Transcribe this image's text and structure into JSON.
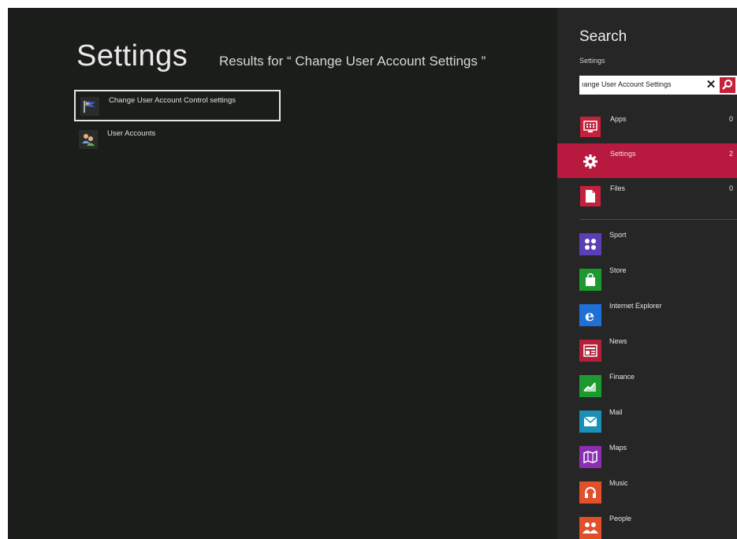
{
  "main": {
    "title": "Settings",
    "results_for": "Results for “ Change User Account Settings ”",
    "results": [
      {
        "label": "Change User Account Control settings",
        "icon": "uac-flag-icon"
      },
      {
        "label": "User Accounts",
        "icon": "users-icon"
      }
    ]
  },
  "search_pane": {
    "title": "Search",
    "scope": "Settings",
    "query": "ıange User Account Settings",
    "categories": [
      {
        "label": "Apps",
        "count": "0",
        "icon": "apps-icon",
        "color": "#c4213d"
      },
      {
        "label": "Settings",
        "count": "2",
        "icon": "gear-icon",
        "color": "#b8193e"
      },
      {
        "label": "Files",
        "count": "0",
        "icon": "file-icon",
        "color": "#c4213d"
      }
    ],
    "apps": [
      {
        "label": "Sport",
        "icon": "sport-icon",
        "color": "#5a3fb5"
      },
      {
        "label": "Store",
        "icon": "store-icon",
        "color": "#1c9a2f"
      },
      {
        "label": "Internet Explorer",
        "icon": "ie-icon",
        "color": "#1f6fd6"
      },
      {
        "label": "News",
        "icon": "news-icon",
        "color": "#b2203a"
      },
      {
        "label": "Finance",
        "icon": "finance-icon",
        "color": "#1c9a2f"
      },
      {
        "label": "Mail",
        "icon": "mail-icon",
        "color": "#1a8fb8"
      },
      {
        "label": "Maps",
        "icon": "maps-icon",
        "color": "#8a2fb0"
      },
      {
        "label": "Music",
        "icon": "music-icon",
        "color": "#e0502a"
      },
      {
        "label": "People",
        "icon": "people-icon",
        "color": "#e0502a"
      }
    ],
    "accent_color": "#b8193e"
  }
}
